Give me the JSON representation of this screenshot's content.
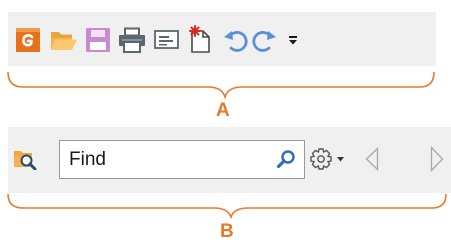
{
  "toolbar_a": {
    "callout_label": "A",
    "buttons": [
      {
        "name": "app-logo-button",
        "icon": "app-logo-icon"
      },
      {
        "name": "open-button",
        "icon": "folder-open-icon"
      },
      {
        "name": "save-button",
        "icon": "save-icon"
      },
      {
        "name": "print-button",
        "icon": "print-icon"
      },
      {
        "name": "print-preview-button",
        "icon": "print-preview-icon"
      },
      {
        "name": "new-button",
        "icon": "new-document-icon"
      },
      {
        "name": "undo-button",
        "icon": "undo-icon"
      },
      {
        "name": "redo-button",
        "icon": "redo-icon"
      },
      {
        "name": "customize-toolbar-button",
        "icon": "overflow-dropdown-icon"
      }
    ]
  },
  "toolbar_b": {
    "callout_label": "B",
    "find_placeholder": "Find",
    "buttons": [
      {
        "name": "find-in-folder-button",
        "icon": "folder-search-icon"
      },
      {
        "name": "find-search-button",
        "icon": "magnifier-icon"
      },
      {
        "name": "find-options-button",
        "icon": "gear-dropdown-icon"
      },
      {
        "name": "find-previous-button",
        "icon": "triangle-left-icon"
      },
      {
        "name": "find-next-button",
        "icon": "triangle-right-icon"
      }
    ]
  },
  "colors": {
    "callout": "#e8792a",
    "toolbar_bg": "#f0f0f0",
    "app_logo": "#e8721c",
    "folder": "#f6b24f",
    "save": "#c98ad0",
    "arrows": "#5b8fd6",
    "nav_disabled": "#a8a8a8",
    "search_icon": "#2f6fb5"
  }
}
